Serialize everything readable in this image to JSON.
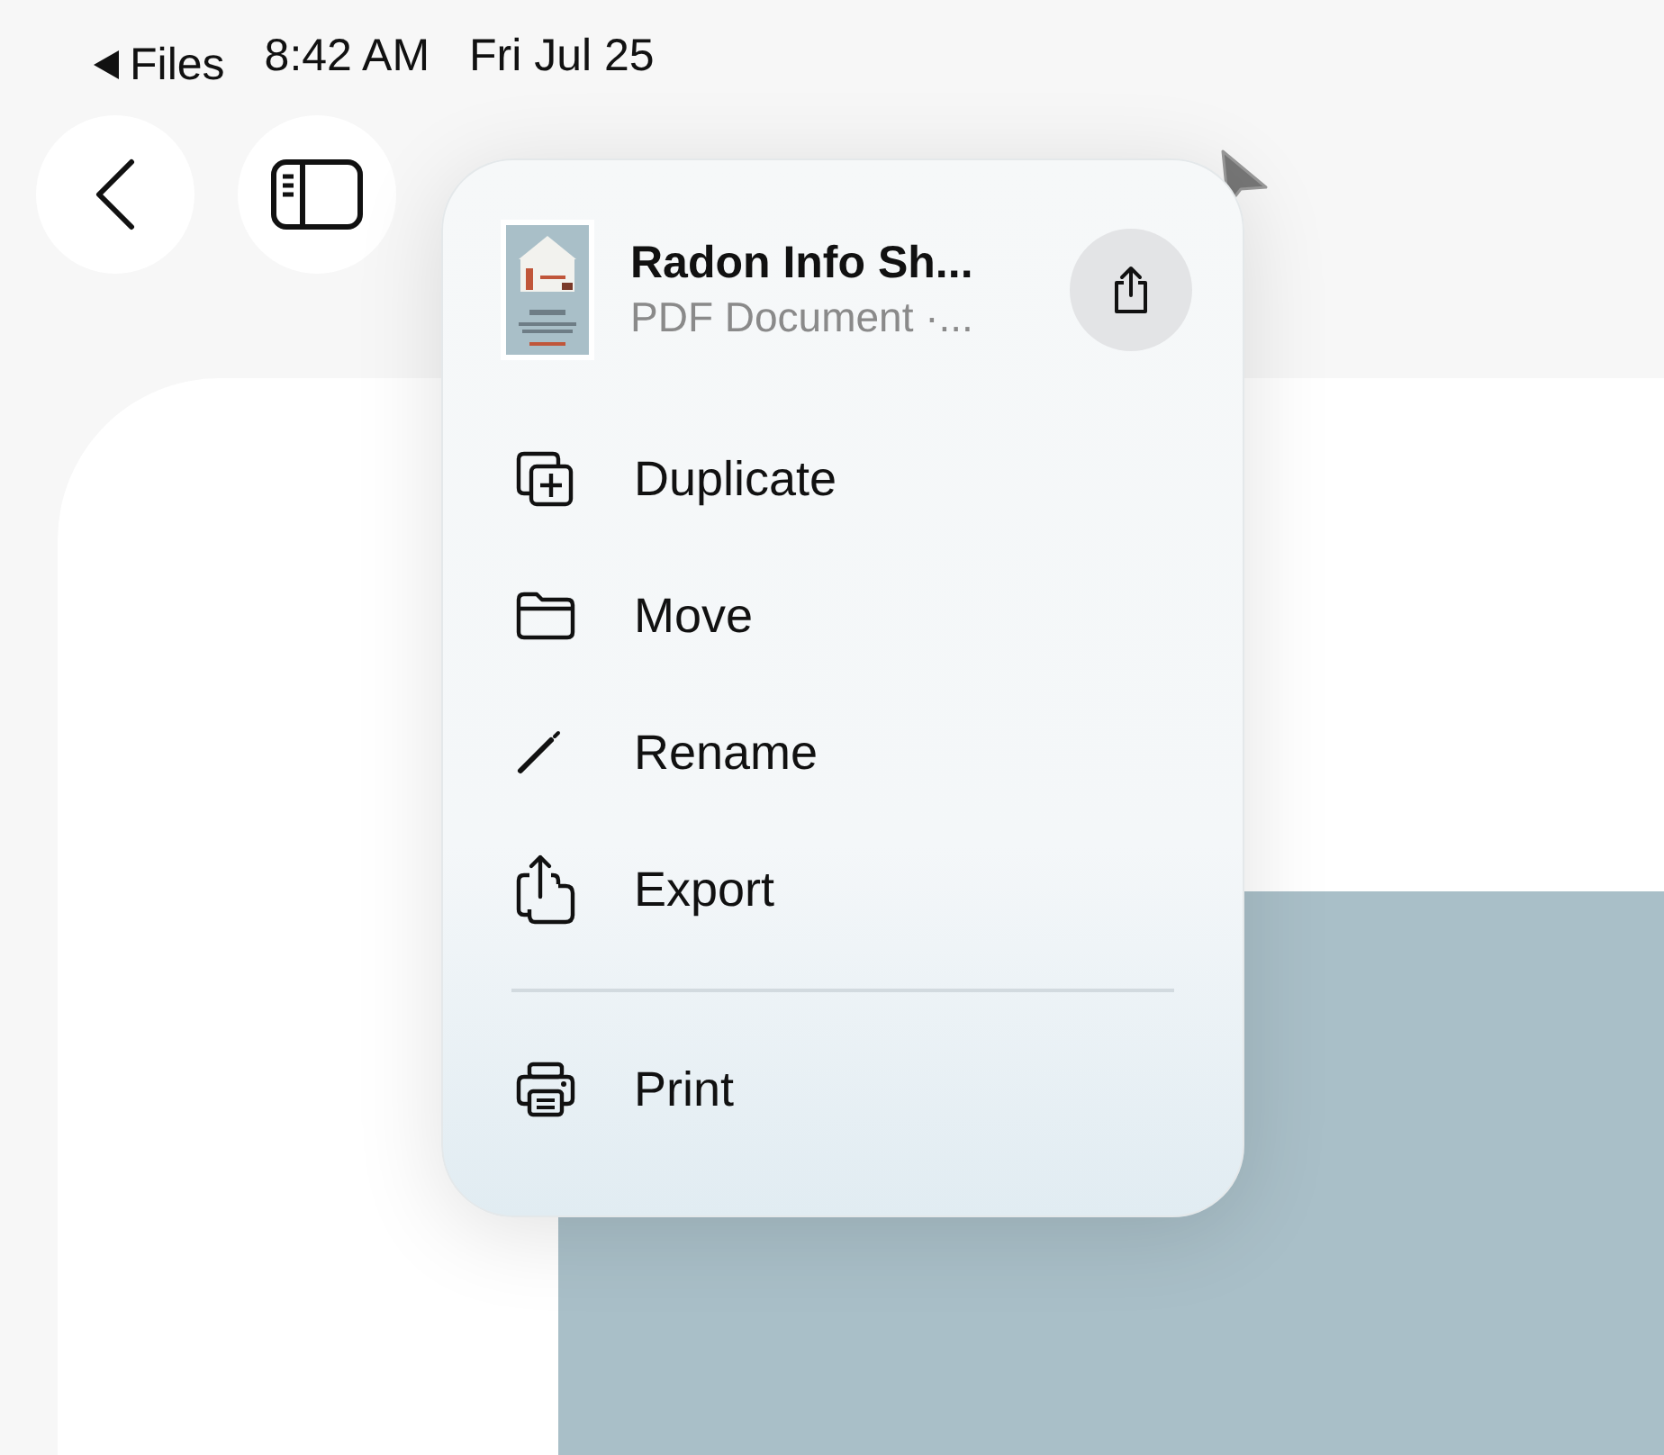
{
  "status_bar": {
    "back_app": "Files",
    "time": "8:42 AM",
    "date": "Fri Jul 25"
  },
  "menu": {
    "file": {
      "title": "Radon Info Sh...",
      "subtitle": "PDF Document ·..."
    },
    "groups": [
      [
        {
          "label": "Duplicate"
        },
        {
          "label": "Move"
        },
        {
          "label": "Rename"
        },
        {
          "label": "Export"
        }
      ],
      [
        {
          "label": "Print"
        }
      ]
    ]
  }
}
